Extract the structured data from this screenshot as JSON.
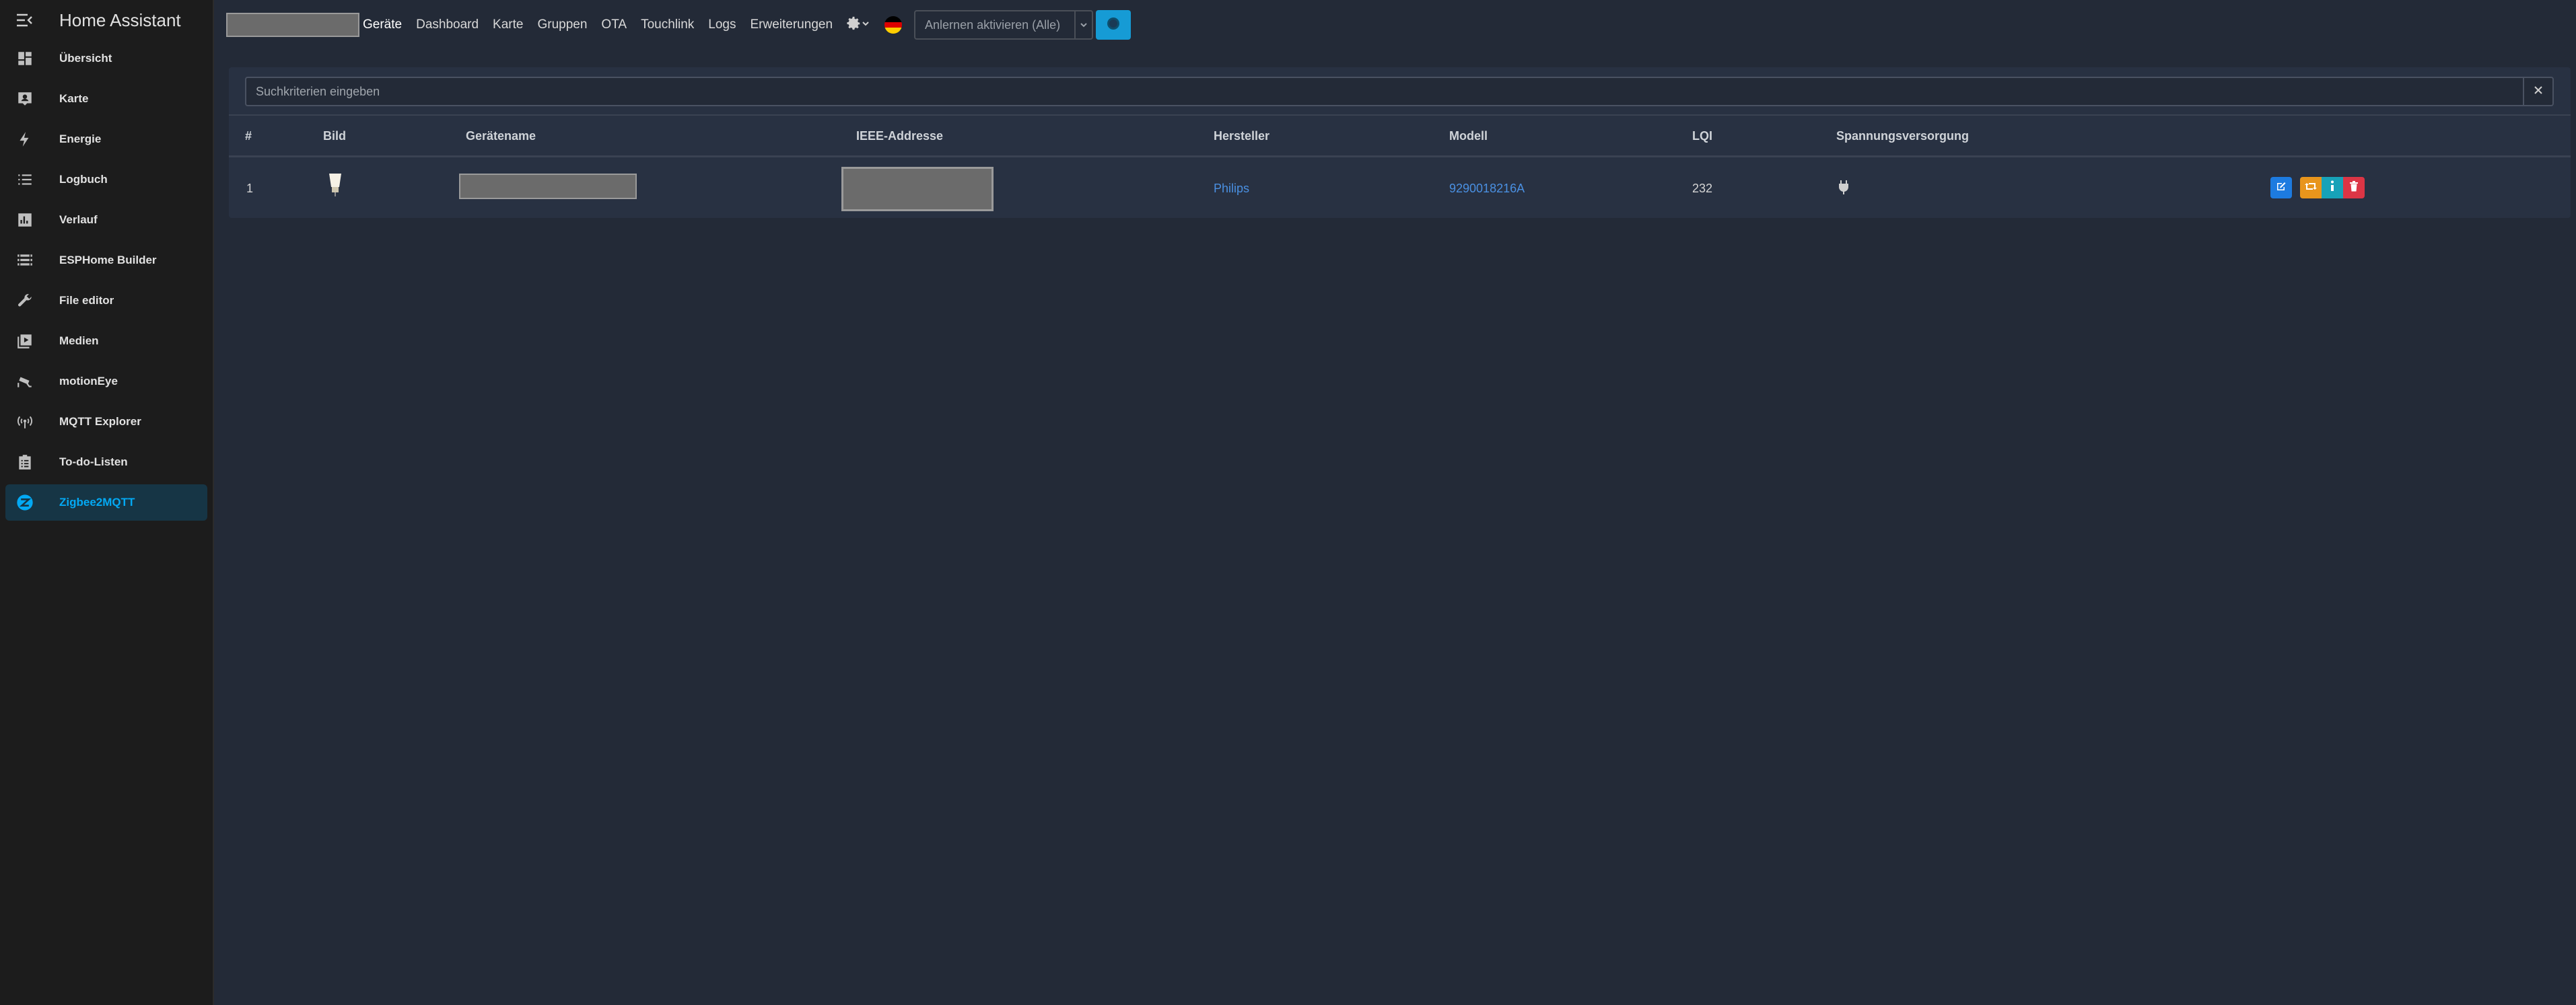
{
  "app": {
    "title": "Home Assistant"
  },
  "sidebar": {
    "items": [
      {
        "label": "Übersicht",
        "icon": "dashboard-icon"
      },
      {
        "label": "Karte",
        "icon": "map-account-icon"
      },
      {
        "label": "Energie",
        "icon": "lightning-icon"
      },
      {
        "label": "Logbuch",
        "icon": "list-icon"
      },
      {
        "label": "Verlauf",
        "icon": "chart-box-icon"
      },
      {
        "label": "ESPHome Builder",
        "icon": "esphome-icon"
      },
      {
        "label": "File editor",
        "icon": "wrench-icon"
      },
      {
        "label": "Medien",
        "icon": "play-box-icon"
      },
      {
        "label": "motionEye",
        "icon": "cctv-icon"
      },
      {
        "label": "MQTT Explorer",
        "icon": "antenna-icon"
      },
      {
        "label": "To-do-Listen",
        "icon": "clipboard-list-icon"
      },
      {
        "label": "Zigbee2MQTT",
        "icon": "zigbee-icon",
        "active": true
      }
    ]
  },
  "topnav": {
    "links": [
      "Geräte",
      "Dashboard",
      "Karte",
      "Gruppen",
      "OTA",
      "Touchlink",
      "Logs",
      "Erweiterungen"
    ],
    "join": {
      "label": "Anlernen aktivieren (Alle)"
    }
  },
  "search": {
    "placeholder": "Suchkriterien eingeben"
  },
  "table": {
    "headers": {
      "num": "#",
      "image": "Bild",
      "name": "Gerätename",
      "ieee": "IEEE-Addresse",
      "vendor": "Hersteller",
      "model": "Modell",
      "lqi": "LQI",
      "power": "Spannungsversorgung"
    },
    "rows": [
      {
        "num": "1",
        "vendor": "Philips",
        "model": "9290018216A",
        "lqi": "232",
        "power_icon": "plug-icon"
      }
    ]
  },
  "colors": {
    "accent": "#03a9f4",
    "link": "#4a90e2",
    "edit": "#1d7be0",
    "rename": "#e8951c",
    "info": "#17a2b8",
    "delete": "#dc3545"
  }
}
